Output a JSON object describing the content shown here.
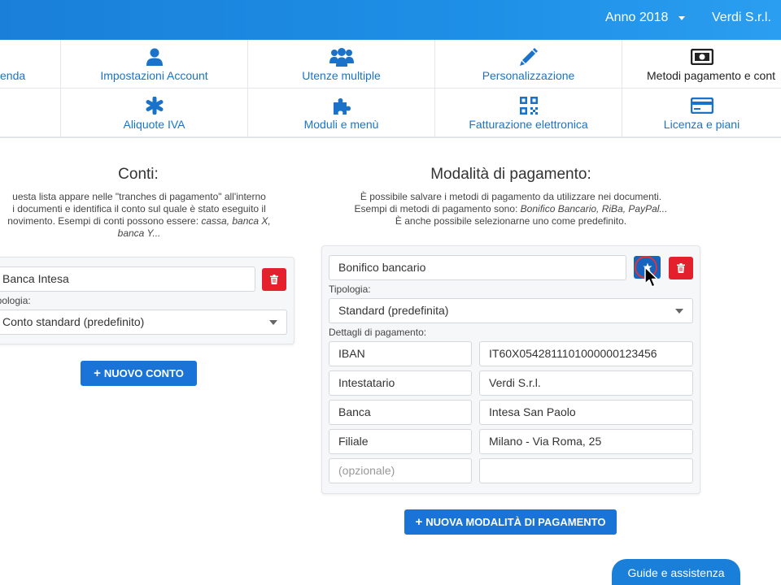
{
  "topbar": {
    "year": "Anno 2018",
    "company": "Verdi S.r.l."
  },
  "settings": {
    "row1": [
      {
        "label": "enda",
        "icon": ""
      },
      {
        "label": "Impostazioni Account",
        "icon": "user-icon"
      },
      {
        "label": "Utenze multiple",
        "icon": "users-icon"
      },
      {
        "label": "Personalizzazione",
        "icon": "pencil-icon"
      },
      {
        "label": "Metodi pagamento e cont",
        "icon": "money-icon"
      }
    ],
    "row2": [
      {
        "label": "",
        "icon": ""
      },
      {
        "label": "Aliquote IVA",
        "icon": "asterisk-icon"
      },
      {
        "label": "Moduli e menù",
        "icon": "puzzle-icon"
      },
      {
        "label": "Fatturazione elettronica",
        "icon": "qrcode-icon"
      },
      {
        "label": "Licenza e piani",
        "icon": "credit-card-icon"
      }
    ]
  },
  "accounts": {
    "title": "Conti:",
    "desc_line1": "uesta lista appare nelle \"tranches di pagamento\" all'interno",
    "desc_line2": "i documenti e identifica il conto sul quale è stato eseguito il",
    "desc_line3": "novimento. Esempi di conti possono essere: ",
    "desc_line3_em": "cassa, banca X,",
    "desc_line4_em": "banca Y...",
    "account_name": "Banca Intesa",
    "type_label": "ipologia:",
    "type_value": "Conto standard (predefinito)",
    "new_button": "NUOVO CONTO"
  },
  "payment_methods": {
    "title": "Modalità di pagamento:",
    "desc_line1": "È possibile salvare i metodi di pagamento da utilizzare nei documenti.",
    "desc_line2": "Esempi di metodi di pagamento sono: ",
    "desc_line2_em": "Bonifico Bancario, RiBa, PayPal...",
    "desc_line3": "È anche possibile selezionarne uno come predefinito.",
    "method_name": "Bonifico bancario",
    "type_label": "Tipologia:",
    "type_value": "Standard (predefinita)",
    "details_label": "Dettagli di pagamento:",
    "details": [
      {
        "key": "IBAN",
        "value": "IT60X0542811101000000123456"
      },
      {
        "key": "Intestatario",
        "value": "Verdi S.r.l."
      },
      {
        "key": "Banca",
        "value": "Intesa San Paolo"
      },
      {
        "key": "Filiale",
        "value": "Milano - Via Roma, 25"
      }
    ],
    "extra_key_placeholder": "(opzionale)",
    "new_button": "NUOVA MODALITÀ DI PAGAMENTO"
  },
  "help_button": "Guide e assistenza",
  "colors": {
    "primary": "#1a73d6",
    "danger": "#e3202b",
    "topbar": "#1e8fe6",
    "link": "#1a73c9"
  }
}
